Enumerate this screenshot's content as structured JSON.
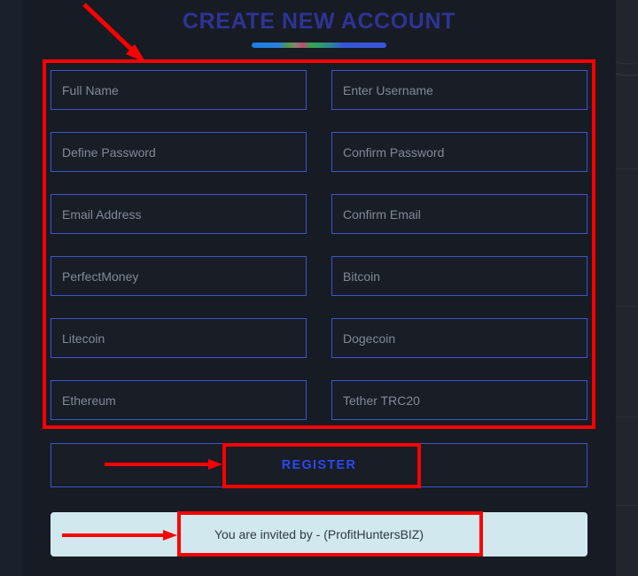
{
  "page": {
    "title": "CREATE NEW ACCOUNT",
    "background_color": "#171c24",
    "accent_border_color": "#3d54cc",
    "title_color": "#2f3394",
    "annotation_color": "#fc0000"
  },
  "form": {
    "fields": [
      {
        "name": "full-name",
        "placeholder": "Full Name",
        "value": ""
      },
      {
        "name": "username",
        "placeholder": "Enter Username",
        "value": ""
      },
      {
        "name": "define-password",
        "placeholder": "Define Password",
        "value": ""
      },
      {
        "name": "confirm-password",
        "placeholder": "Confirm Password",
        "value": ""
      },
      {
        "name": "email-address",
        "placeholder": "Email Address",
        "value": ""
      },
      {
        "name": "confirm-email",
        "placeholder": "Confirm Email",
        "value": ""
      },
      {
        "name": "perfectmoney",
        "placeholder": "PerfectMoney",
        "value": ""
      },
      {
        "name": "bitcoin",
        "placeholder": "Bitcoin",
        "value": ""
      },
      {
        "name": "litecoin",
        "placeholder": "Litecoin",
        "value": ""
      },
      {
        "name": "dogecoin",
        "placeholder": "Dogecoin",
        "value": ""
      },
      {
        "name": "ethereum",
        "placeholder": "Ethereum",
        "value": ""
      },
      {
        "name": "tether-trc20",
        "placeholder": "Tether TRC20",
        "value": ""
      }
    ],
    "submit_label": "REGISTER"
  },
  "invite": {
    "text": "You are invited by - (ProfitHuntersBIZ)",
    "background_color": "#d2e8ef",
    "text_color": "#2d3a42"
  }
}
